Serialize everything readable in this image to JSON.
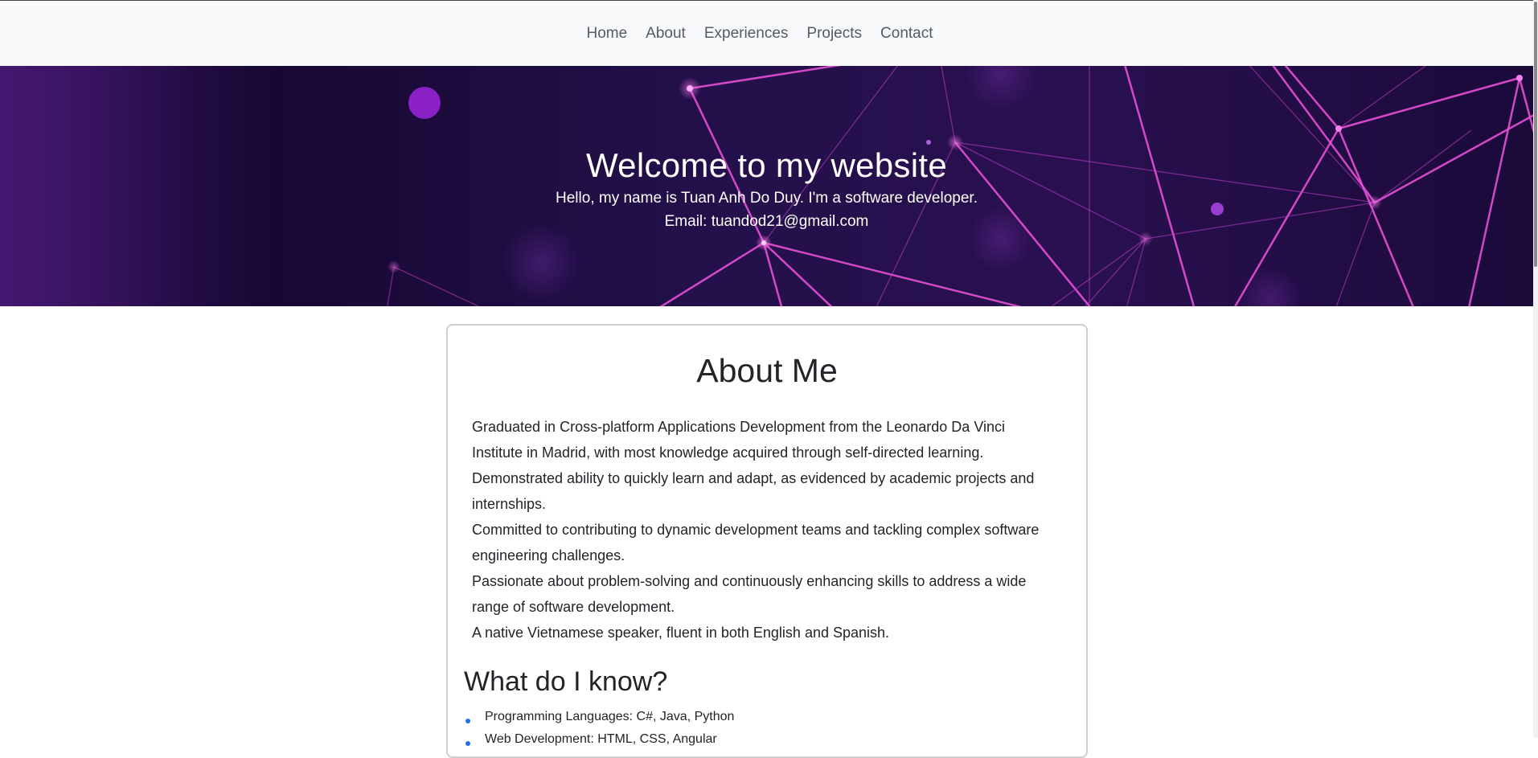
{
  "nav": {
    "items": [
      {
        "label": "Home"
      },
      {
        "label": "About"
      },
      {
        "label": "Experiences"
      },
      {
        "label": "Projects"
      },
      {
        "label": "Contact"
      }
    ]
  },
  "hero": {
    "title": "Welcome to my website",
    "intro": "Hello, my name is Tuan Anh Do Duy. I'm a software developer.",
    "email": "Email: tuandod21@gmail.com"
  },
  "about": {
    "title": "About Me",
    "paragraphs": [
      "Graduated in Cross-platform Applications Development from the Leonardo Da Vinci Institute in Madrid, with most knowledge acquired through self-directed learning.",
      "Demonstrated ability to quickly learn and adapt, as evidenced by academic projects and internships.",
      "Committed to contributing to dynamic development teams and tackling complex software engineering challenges.",
      "Passionate about problem-solving and continuously enhancing skills to address a wide range of software development.",
      "A native Vietnamese speaker, fluent in both English and Spanish."
    ],
    "know_title": "What do I know?",
    "know_items": [
      "Programming Languages: C#, Java, Python",
      "Web Development: HTML, CSS, Angular"
    ]
  },
  "colors": {
    "hero_dark": "#170833",
    "hero_purple": "#3b1565",
    "line_pink": "#e84fd6",
    "bullet_blue": "#1f6feb",
    "navbar_bg": "#f8f9fa"
  }
}
